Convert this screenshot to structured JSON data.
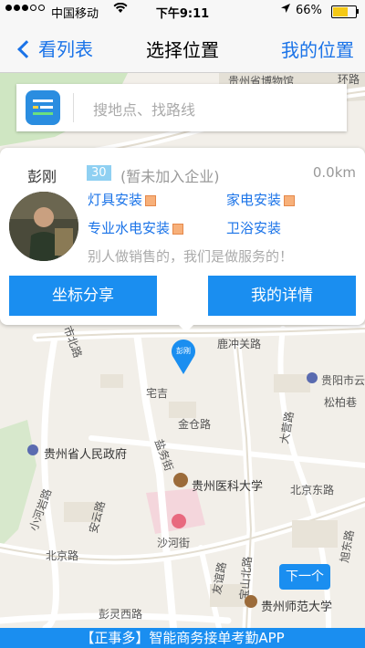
{
  "status_bar": {
    "carrier": "中国移动",
    "time": "下午9:11",
    "battery": "66%",
    "battery_level": 0.66
  },
  "nav": {
    "back_label": "看列表",
    "title": "选择位置",
    "right_label": "我的位置"
  },
  "search": {
    "placeholder": "搜地点、找路线"
  },
  "popup": {
    "name": "彭刚",
    "score": "30",
    "company": "(暂未加入企业)",
    "distance": "0.0km",
    "services": [
      "灯具安装",
      "家电安装",
      "专业水电安装",
      "卫浴安装"
    ],
    "slogan": "别人做销售的，我们是做服务的！",
    "share_button": "坐标分享",
    "detail_button": "我的详情"
  },
  "marker": {
    "label": "彭刚"
  },
  "map": {
    "pois": {
      "museum": "贵州省博物馆",
      "huan_road": "环路",
      "luchong_road": "鹿冲关路",
      "shibei_road": "市北路",
      "guiyang": "贵阳市云",
      "songbai": "松柏巷",
      "zhaiji": "宅吉",
      "jincang_road": "金仓路",
      "dayi_road": "大营路",
      "gov": "贵州省人民政府",
      "yanzhi_street": "盐务街",
      "medical": "贵州医科大学",
      "beijing_east": "北京东路",
      "xiaohe_road": "小河岩路",
      "anyun_road": "安云路",
      "shahe_street": "沙河街",
      "beijing_road": "北京路",
      "youyi_road": "友谊路",
      "baoshan_north": "宝山北路",
      "xudong_road": "旭东路",
      "normal_univ": "贵州师范大学",
      "penglin_road": "彭灵西路"
    }
  },
  "next_button": "下一个",
  "bottom_banner": "【正事多】智能商务接单考勤APP"
}
